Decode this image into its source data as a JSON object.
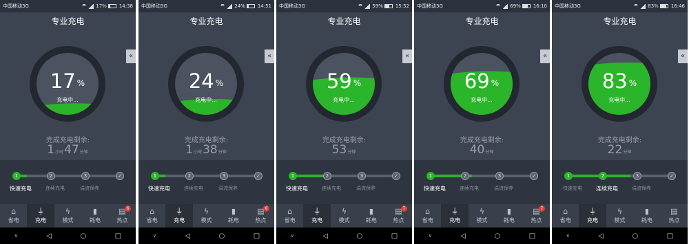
{
  "app_title": "专业充电",
  "side_tab_glyph": "«",
  "charging_label": "充电中...",
  "percent_sign": "%",
  "remaining_label": "完成充电剩余:",
  "hour_unit": "小时",
  "minute_unit": "分钟",
  "stage_labels": [
    "快速充电",
    "连续充电",
    "涓流保养"
  ],
  "stage_numbers": [
    "1",
    "2",
    "3"
  ],
  "stage_check": "✓",
  "nav_items": [
    {
      "label": "省电",
      "icon": "home-icon",
      "glyph": "⌂"
    },
    {
      "label": "充电",
      "icon": "plug-icon",
      "glyph": "⏚"
    },
    {
      "label": "模式",
      "icon": "lightning-icon",
      "glyph": "ϟ"
    },
    {
      "label": "耗电",
      "icon": "bar-chart-icon",
      "glyph": "▮"
    },
    {
      "label": "热点",
      "icon": "document-icon",
      "glyph": "▤"
    }
  ],
  "system_nav_icons": [
    "collapse-icon",
    "back-icon",
    "home-circle-icon",
    "recents-icon"
  ],
  "colors": {
    "background": "#3c4452",
    "gauge_ring": "#23272f",
    "gauge_inner": "#4b5260",
    "charge_fill": "#2bb52a",
    "badge": "#e23b3b"
  },
  "screens": [
    {
      "carrier": "中国移动3G",
      "battery_pct": "17%",
      "time": "14:38",
      "percent": "17",
      "level": 0.17,
      "remaining": {
        "hours": "1",
        "minutes": "47"
      },
      "active_stage": 0,
      "badge": "6",
      "stage_progress": 0.1
    },
    {
      "carrier": "中国移动3G",
      "battery_pct": "24%",
      "time": "14:51",
      "percent": "24",
      "level": 0.24,
      "remaining": {
        "hours": "1",
        "minutes": "38"
      },
      "active_stage": 0,
      "badge": "6",
      "stage_progress": 0.1
    },
    {
      "carrier": "中国移动3G",
      "battery_pct": "59%",
      "time": "15:52",
      "percent": "59",
      "level": 0.59,
      "remaining": {
        "hours": "",
        "minutes": "53"
      },
      "active_stage": 0,
      "badge": "7",
      "stage_progress": 0.35
    },
    {
      "carrier": "中国移动3G",
      "battery_pct": "69%",
      "time": "16:10",
      "percent": "69",
      "level": 0.69,
      "remaining": {
        "hours": "",
        "minutes": "40"
      },
      "active_stage": 0,
      "badge": "7",
      "stage_progress": 0.4
    },
    {
      "carrier": "中国移动3G",
      "battery_pct": "83%",
      "time": "16:46",
      "percent": "83",
      "level": 0.83,
      "remaining": {
        "hours": "",
        "minutes": "22"
      },
      "active_stage": 1,
      "badge": "",
      "stage_progress": 0.6
    }
  ]
}
